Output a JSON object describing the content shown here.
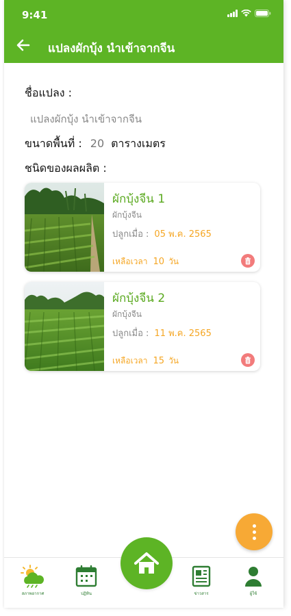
{
  "status_bar": {
    "time": "9:41"
  },
  "header": {
    "title": "แปลงผักบุ้ง นำเข้าจากจีน"
  },
  "plot": {
    "name_label": "ชื่อแปลง  :",
    "name_value": "แปลงผักบุ้ง นำเข้าจากจีน",
    "area_label": "ขนาดพื้นที่ :",
    "area_value": "20",
    "area_unit": "ตารางเมตร",
    "product_type_label": "ชนิดของผลผลิต :"
  },
  "crops": [
    {
      "name": "ผักบุ้งจีน 1",
      "type": "ผักบุ้งจีน",
      "planted_label": "ปลูกเมื่อ :",
      "planted_date": "05 พ.ค. 2565",
      "remaining_label": "เหลือเวลา",
      "remaining_value": "10",
      "remaining_unit": "วัน"
    },
    {
      "name": "ผักบุ้งจีน 2",
      "type": "ผักบุ้งจีน",
      "planted_label": "ปลูกเมื่อ :",
      "planted_date": "11 พ.ค. 2565",
      "remaining_label": "เหลือเวลา",
      "remaining_value": "15",
      "remaining_unit": "วัน"
    }
  ],
  "bottom_nav": {
    "weather": "สภาพอากาศ",
    "calendar": "ปฏิทิน",
    "news": "ข่าวสาร",
    "profile": "ผู้ใช้"
  },
  "icons": {
    "back": "arrow-left-icon",
    "delete": "trash-icon",
    "more": "more-vert-icon",
    "home": "home-icon",
    "weather": "weather-icon",
    "calendar": "calendar-icon",
    "news": "news-icon",
    "profile": "user-icon"
  },
  "colors": {
    "primary": "#5db425",
    "accent": "#f7a935",
    "delete": "#f27b7b",
    "crop_name": "#5aa91f"
  }
}
